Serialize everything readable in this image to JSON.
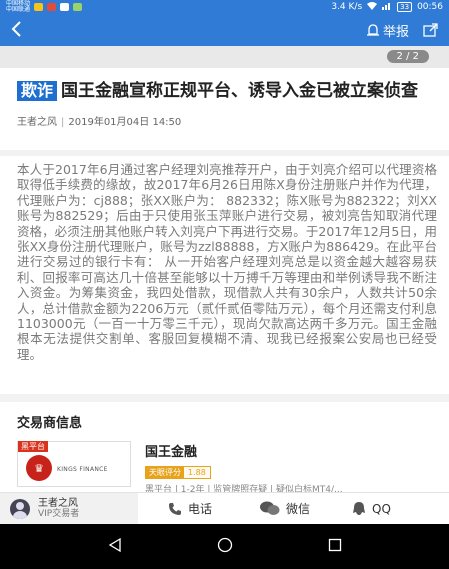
{
  "status_bar": {
    "carrier_1": "中国移动",
    "carrier_2": "中国联通",
    "network_speed": "3.4 K/s",
    "battery": "33",
    "time": "00:56"
  },
  "nav": {
    "report_label": "举报"
  },
  "gallery": {
    "page_indicator": "2 / 2"
  },
  "article": {
    "tag": "欺诈",
    "title": "国王金融宣称正规平台、诱导入金已被立案侦查",
    "author": "王者之风",
    "date": "2019年01月04日 14:50",
    "body": "本人于2017年6月通过客户经理刘亮推荐开户，由于刘亮介绍可以代理资格取得低手续费的缘故，故2017年6月26日用陈X身份注册账户并作为代理，代理账户为：cj888；张XX账户为： 882332；陈X账号为882322；刘XX账号为882529；后由于只使用张玉萍账户进行交易，被刘亮告知取消代理资格，必须注册其他账户转入刘亮户下再进行交易。于2017年12月5日，用张XX身份注册代理账户，账号为zzl88888，方X账户为886429。在此平台进行交易过的银行卡有： 从一开始客户经理刘亮总是以资金越大越容易获利、回报率可高达几十倍甚至能够以十万搏千万等理由和举例诱导我不断注入资金。为筹集资金，我四处借款，现借款人共有30余户，人数共计50余人，总计借款金额为2206万元（贰仟贰佰零陆万元），每个月还需支付利息1103000元（一百一十万零三千元），现尚欠款高达两千多万元。国王金融根本无法提供交割单、客服回复模糊不清、现我已经报案公安局也已经受理。"
  },
  "broker_section": {
    "title": "交易商信息",
    "badge": "黑平台",
    "logo_text": "KINGS FINANCE",
    "name": "国王金融",
    "score_label": "天眼评分",
    "score_value": "1.88",
    "description": "黑平台 | 1-2年 | 监管牌照存疑 | 疑似白标MT4/..."
  },
  "bottom_bar": {
    "user_name": "王者之风",
    "user_role": "VIP交易者",
    "phone_label": "电话",
    "wechat_label": "微信",
    "qq_label": "QQ"
  },
  "colors": {
    "primary": "#2f7bd6",
    "tag": "#1f6fd1",
    "black_badge": "#d9331e",
    "score": "#e8a21b"
  }
}
